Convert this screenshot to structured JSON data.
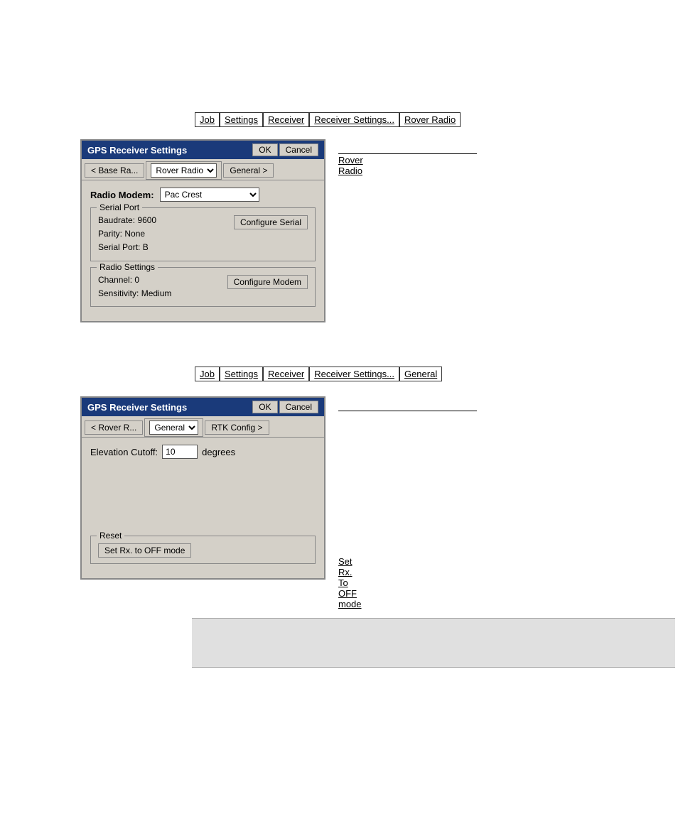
{
  "breadcrumb1": {
    "items": [
      "Job",
      "Settings",
      "Receiver",
      "Receiver Settings...",
      "Rover Radio"
    ]
  },
  "breadcrumb2": {
    "items": [
      "Job",
      "Settings",
      "Receiver",
      "Receiver Settings...",
      "General"
    ]
  },
  "dialog1": {
    "title": "GPS Receiver Settings",
    "ok_label": "OK",
    "cancel_label": "Cancel",
    "tab_prev": "< Base Ra...",
    "tab_current": "Rover Radio",
    "tab_next": "General >",
    "radio_modem_label": "Radio Modem:",
    "radio_modem_value": "Pac Crest",
    "serial_port_group": "Serial Port",
    "baudrate_label": "Baudrate:",
    "baudrate_value": "9600",
    "parity_label": "Parity:",
    "parity_value": "None",
    "serial_port_label": "Serial Port:",
    "serial_port_value": "B",
    "configure_serial_label": "Configure Serial",
    "radio_settings_group": "Radio Settings",
    "channel_label": "Channel:",
    "channel_value": "0",
    "sensitivity_label": "Sensitivity:",
    "sensitivity_value": "Medium",
    "configure_modem_label": "Configure Modem"
  },
  "dialog2": {
    "title": "GPS Receiver Settings",
    "ok_label": "OK",
    "cancel_label": "Cancel",
    "tab_prev": "< Rover R...",
    "tab_current": "General",
    "tab_next": "RTK Config >",
    "elevation_cutoff_label": "Elevation Cutoff:",
    "elevation_cutoff_value": "10",
    "degrees_label": "degrees",
    "reset_group": "Reset",
    "set_rx_label": "Set Rx. to OFF mode"
  },
  "annotation1": {
    "label": "Rover Radio",
    "underline": true
  },
  "annotation2": {
    "label": "Set Rx. To OFF mode",
    "underline": true
  },
  "footer": {}
}
